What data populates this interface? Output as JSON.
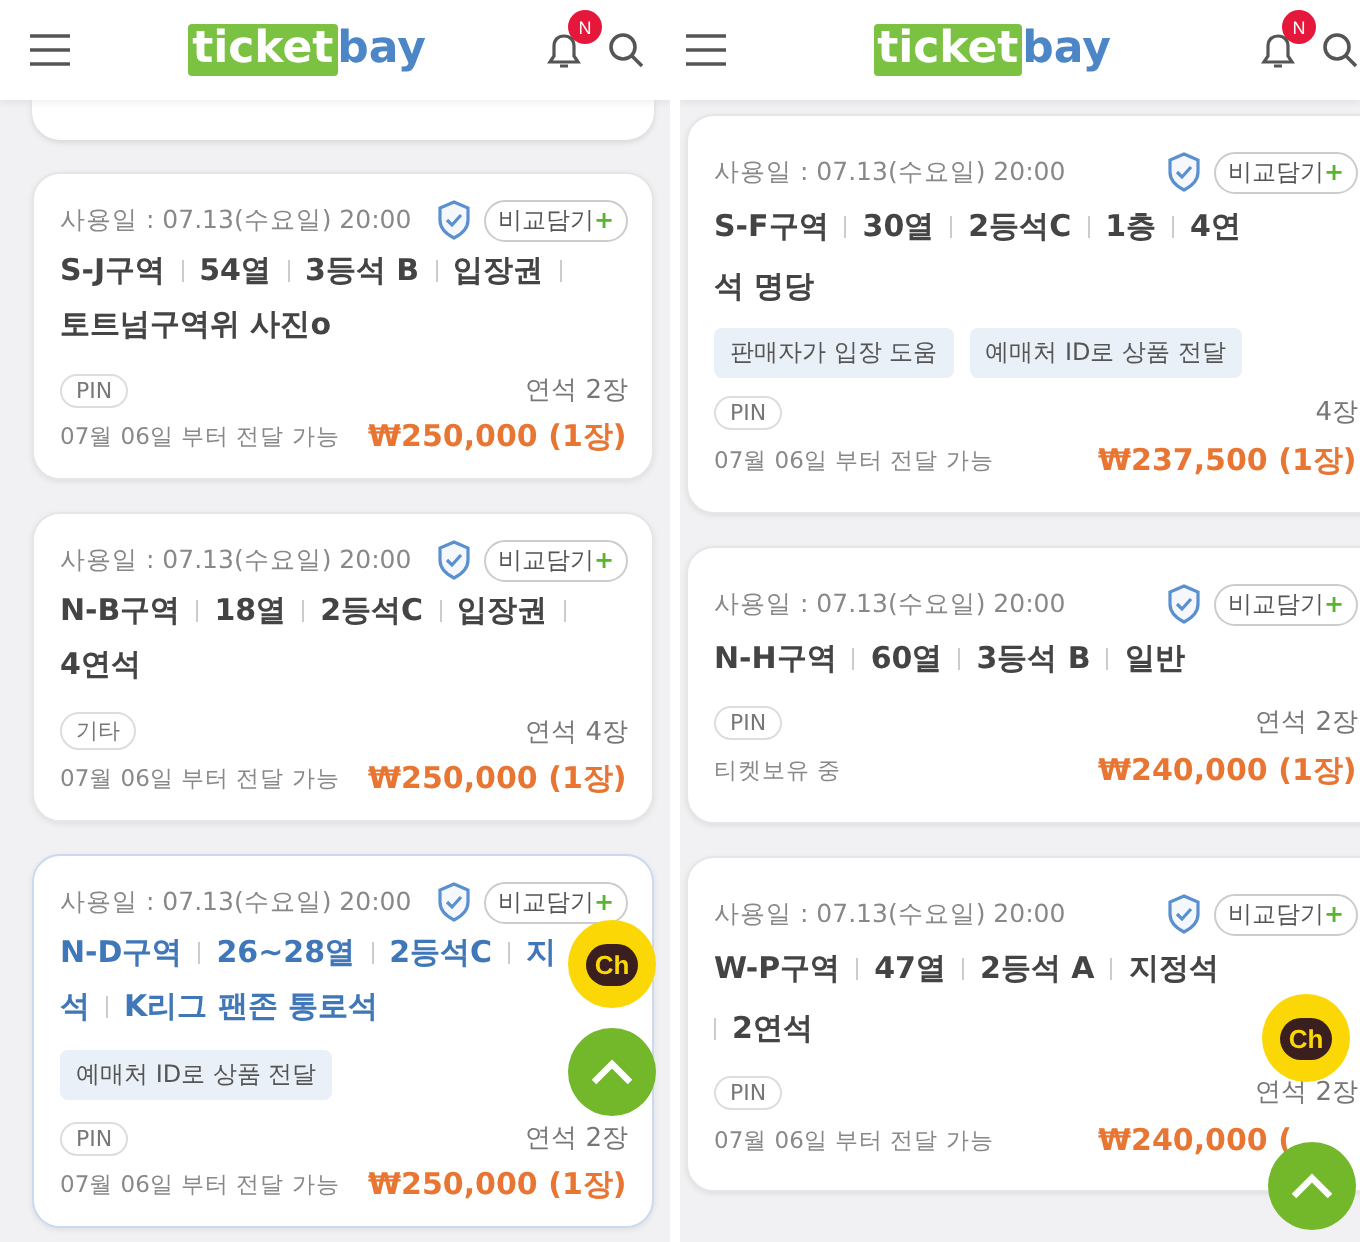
{
  "panels": [
    {
      "header": {
        "logo_box": "ticket",
        "logo_rest": "bay",
        "badge": "N"
      },
      "partial_top": true,
      "cards": [
        {
          "date": "사용일 : 07.13(수요일) 20:00",
          "compare": "비교담기",
          "compare_plus": "+",
          "highlighted": false,
          "lines": [
            [
              {
                "kind": "text",
                "text": "S-J구역"
              },
              {
                "kind": "divider"
              },
              {
                "kind": "text",
                "text": "54열"
              },
              {
                "kind": "divider"
              },
              {
                "kind": "text",
                "text": "3등석 B"
              },
              {
                "kind": "divider"
              },
              {
                "kind": "text",
                "text": "입장권"
              },
              {
                "kind": "divider"
              }
            ],
            [
              {
                "kind": "text",
                "text": "토트넘구역위 사진o"
              }
            ]
          ],
          "badge": "PIN",
          "count": "연석 2장",
          "delivery": "07월 06일 부터 전달 가능",
          "price": "₩250,000 (1장)"
        },
        {
          "date": "사용일 : 07.13(수요일) 20:00",
          "compare": "비교담기",
          "compare_plus": "+",
          "highlighted": false,
          "lines": [
            [
              {
                "kind": "text",
                "text": "N-B구역"
              },
              {
                "kind": "divider"
              },
              {
                "kind": "text",
                "text": "18열"
              },
              {
                "kind": "divider"
              },
              {
                "kind": "text",
                "text": "2등석C"
              },
              {
                "kind": "divider"
              },
              {
                "kind": "text",
                "text": "입장권"
              },
              {
                "kind": "divider"
              }
            ],
            [
              {
                "kind": "text",
                "text": "4연석"
              }
            ]
          ],
          "badge": "기타",
          "count": "연석 4장",
          "delivery": "07월 06일 부터 전달 가능",
          "price": "₩250,000 (1장)"
        },
        {
          "date": "사용일 : 07.13(수요일) 20:00",
          "compare": "비교담기",
          "compare_plus": "+",
          "highlighted": true,
          "lines": [
            [
              {
                "kind": "text",
                "text": "N-D구역"
              },
              {
                "kind": "divider"
              },
              {
                "kind": "text",
                "text": "26~28열"
              },
              {
                "kind": "divider"
              },
              {
                "kind": "text",
                "text": "2등석C"
              },
              {
                "kind": "divider"
              },
              {
                "kind": "text",
                "text": "지"
              }
            ],
            [
              {
                "kind": "text",
                "text": "석"
              },
              {
                "kind": "divider"
              },
              {
                "kind": "text",
                "text": "K리그 팬존 통로석"
              }
            ]
          ],
          "tags": [
            "예매처 ID로 상품 전달"
          ],
          "badge": "PIN",
          "count": "연석 2장",
          "delivery": "07월 06일 부터 전달 가능",
          "price": "₩250,000 (1장)"
        }
      ],
      "chat": "Ch"
    },
    {
      "header": {
        "logo_box": "ticket",
        "logo_rest": "bay",
        "badge": "N"
      },
      "cards": [
        {
          "date": "사용일 : 07.13(수요일) 20:00",
          "compare": "비교담기",
          "compare_plus": "+",
          "highlighted": false,
          "lines": [
            [
              {
                "kind": "text",
                "text": "S-F구역"
              },
              {
                "kind": "divider"
              },
              {
                "kind": "text",
                "text": "30열"
              },
              {
                "kind": "divider"
              },
              {
                "kind": "text",
                "text": "2등석C"
              },
              {
                "kind": "divider"
              },
              {
                "kind": "text",
                "text": "1층"
              },
              {
                "kind": "divider"
              },
              {
                "kind": "text",
                "text": "4연"
              }
            ],
            [
              {
                "kind": "text",
                "text": "석 명당"
              }
            ]
          ],
          "tags": [
            "판매자가 입장 도움",
            "예매처 ID로 상품 전달"
          ],
          "badge": "PIN",
          "count": "4장",
          "delivery": "07월 06일 부터 전달 가능",
          "price": "₩237,500 (1장)"
        },
        {
          "date": "사용일 : 07.13(수요일) 20:00",
          "compare": "비교담기",
          "compare_plus": "+",
          "highlighted": false,
          "lines": [
            [
              {
                "kind": "text",
                "text": "N-H구역"
              },
              {
                "kind": "divider"
              },
              {
                "kind": "text",
                "text": "60열"
              },
              {
                "kind": "divider"
              },
              {
                "kind": "text",
                "text": "3등석 B"
              },
              {
                "kind": "divider"
              },
              {
                "kind": "text",
                "text": "일반"
              }
            ]
          ],
          "badge": "PIN",
          "count": "연석 2장",
          "delivery": "티켓보유 중",
          "price": "₩240,000 (1장)"
        },
        {
          "date": "사용일 : 07.13(수요일) 20:00",
          "compare": "비교담기",
          "compare_plus": "+",
          "highlighted": false,
          "lines": [
            [
              {
                "kind": "text",
                "text": "W-P구역"
              },
              {
                "kind": "divider"
              },
              {
                "kind": "text",
                "text": "47열"
              },
              {
                "kind": "divider"
              },
              {
                "kind": "text",
                "text": "2등석 A"
              },
              {
                "kind": "divider"
              },
              {
                "kind": "text",
                "text": "지정석"
              }
            ],
            [
              {
                "kind": "divider"
              },
              {
                "kind": "text",
                "text": "2연석"
              }
            ]
          ],
          "badge": "PIN",
          "count": "연석 2장",
          "delivery": "07월 06일 부터 전달 가능",
          "price": "₩240,000 ("
        }
      ],
      "chat": "Ch"
    }
  ]
}
